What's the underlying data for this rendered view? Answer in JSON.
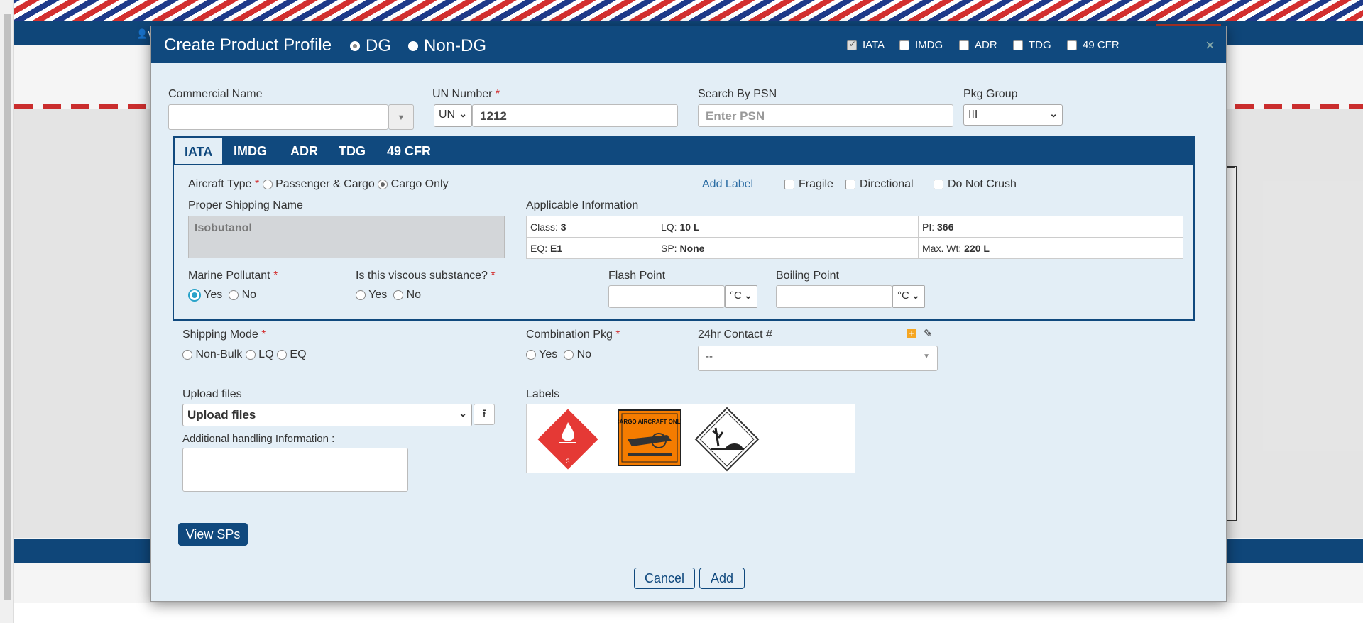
{
  "background": {
    "user_link": "W"
  },
  "modal": {
    "title": "Create Product Profile",
    "type_options": [
      {
        "label": "DG",
        "selected": true
      },
      {
        "label": "Non-DG",
        "selected": false
      }
    ],
    "regulations": [
      {
        "label": "IATA",
        "checked": true
      },
      {
        "label": "IMDG",
        "checked": false
      },
      {
        "label": "ADR",
        "checked": false
      },
      {
        "label": "TDG",
        "checked": false
      },
      {
        "label": "49 CFR",
        "checked": false
      }
    ],
    "close": "×"
  },
  "form": {
    "commercial_name": {
      "label": "Commercial Name",
      "value": ""
    },
    "un_number": {
      "label": "UN Number",
      "prefix": "UN",
      "value": "1212"
    },
    "search_psn": {
      "label": "Search By PSN",
      "placeholder": "Enter PSN"
    },
    "pkg_group": {
      "label": "Pkg Group",
      "value": "III"
    }
  },
  "tabs": [
    "IATA",
    "IMDG",
    "ADR",
    "TDG",
    "49 CFR"
  ],
  "iata": {
    "aircraft_type": {
      "label": "Aircraft Type",
      "options": [
        "Passenger & Cargo",
        "Cargo Only"
      ],
      "selected": "Cargo Only"
    },
    "add_label": "Add Label",
    "handling_labels": [
      "Fragile",
      "Directional",
      "Do Not Crush"
    ],
    "psn": {
      "label": "Proper Shipping Name",
      "value": "Isobutanol"
    },
    "applicable_info": {
      "label": "Applicable Information",
      "rows": [
        [
          {
            "k": "Class:",
            "v": "3"
          },
          {
            "k": "LQ:",
            "v": "10 L"
          },
          {
            "k": "PI:",
            "v": "366"
          }
        ],
        [
          {
            "k": "EQ:",
            "v": "E1"
          },
          {
            "k": "SP:",
            "v": "None"
          },
          {
            "k": "Max. Wt:",
            "v": "220 L"
          }
        ]
      ]
    },
    "marine_pollutant": {
      "label": "Marine Pollutant",
      "options": [
        "Yes",
        "No"
      ],
      "selected": "Yes"
    },
    "viscous": {
      "label": "Is this viscous substance?",
      "options": [
        "Yes",
        "No"
      ]
    },
    "flash_point": {
      "label": "Flash Point",
      "unit": "°C"
    },
    "boiling_point": {
      "label": "Boiling Point",
      "unit": "°C"
    }
  },
  "shipping": {
    "mode": {
      "label": "Shipping Mode",
      "options": [
        "Non-Bulk",
        "LQ",
        "EQ"
      ]
    },
    "combination": {
      "label": "Combination Pkg",
      "options": [
        "Yes",
        "No"
      ]
    },
    "contact": {
      "label": "24hr Contact #",
      "value": "--"
    }
  },
  "uploads": {
    "label": "Upload files",
    "select_value": "Upload files",
    "additional_label": "Additional handling Information :"
  },
  "labels_section": {
    "label": "Labels",
    "items": [
      "flammable-liquid-class-3",
      "cargo-aircraft-only",
      "environmentally-hazardous"
    ],
    "cao_text": "CARGO AIRCRAFT ONLY",
    "class_number": "3"
  },
  "actions": {
    "view_sps": "View SPs",
    "cancel": "Cancel",
    "add": "Add"
  },
  "colors": {
    "primary": "#10497e",
    "required": "#d32f2f",
    "flammable": "#e53935",
    "cao": "#f57c00"
  }
}
